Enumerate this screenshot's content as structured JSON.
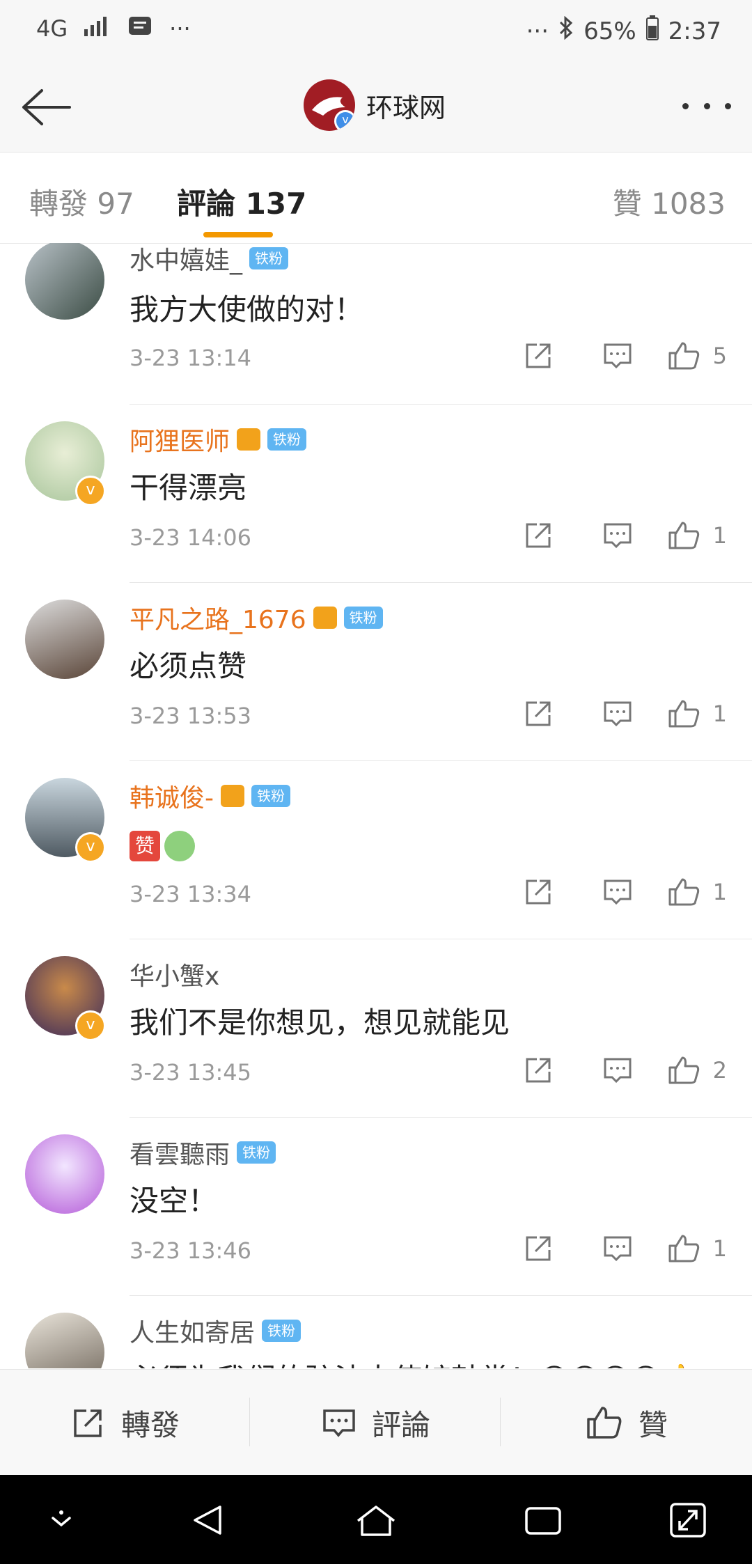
{
  "status_bar": {
    "network": "4G",
    "dots_left": "···",
    "dots_right": "···",
    "bluetooth": "bluetooth-icon",
    "battery": "65%",
    "time": "2:37"
  },
  "header": {
    "title": "环球网",
    "verified": "v"
  },
  "tabs": {
    "repost": "轉發 97",
    "comments": "評論 137",
    "likes": "贊 1083"
  },
  "colors": {
    "accent": "#f39800",
    "orange_name": "#e8731d",
    "tag_blue": "#5fb5f2"
  },
  "comments": [
    {
      "name": "水中嬉娃_",
      "tag": "铁粉",
      "crown": false,
      "vip": false,
      "text": "我方大使做的对！",
      "time": "3-23 13:14",
      "likes": "5"
    },
    {
      "name": "阿狸医师",
      "tag": "铁粉",
      "crown": true,
      "vip": true,
      "text": "干得漂亮",
      "time": "3-23 14:06",
      "likes": "1"
    },
    {
      "name": "平凡之路_1676",
      "tag": "铁粉",
      "crown": true,
      "vip": false,
      "text": "必须点赞",
      "time": "3-23 13:53",
      "likes": "1"
    },
    {
      "name": "韩诚俊-",
      "tag": "铁粉",
      "crown": true,
      "vip": true,
      "text": "",
      "emoji": "赞",
      "time": "3-23 13:34",
      "likes": "1"
    },
    {
      "name": "华小蟹x",
      "tag": "",
      "crown": false,
      "vip": true,
      "text": "我们不是你想见，想见就能见",
      "time": "3-23 13:45",
      "likes": "2"
    },
    {
      "name": "看雲聽雨",
      "tag": "铁粉",
      "crown": false,
      "vip": false,
      "text": "没空！",
      "time": "3-23 13:46",
      "likes": "1"
    },
    {
      "name": "人生如寄居",
      "tag": "铁粉",
      "crown": false,
      "vip": false,
      "text": "必须为我们的驻法大使馆鼓掌！😊😊😊😊👍",
      "time": "",
      "likes": ""
    }
  ],
  "bottom_bar": {
    "repost": "轉發",
    "comment": "評論",
    "like": "贊"
  }
}
